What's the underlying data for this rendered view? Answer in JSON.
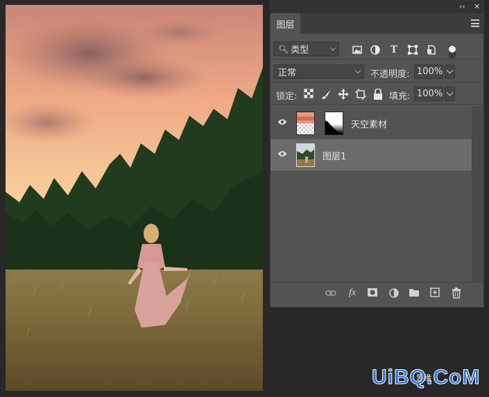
{
  "panel": {
    "window_controls": {
      "collapse": "‹‹",
      "close": "✕"
    },
    "tab_label": "图层",
    "filter": {
      "kind_label": "类型"
    },
    "blend": {
      "mode": "正常",
      "opacity_label": "不透明度:",
      "opacity_value": "100%"
    },
    "lock": {
      "label": "锁定:",
      "fill_label": "填充:",
      "fill_value": "100%"
    },
    "layers": [
      {
        "name": "天空素材",
        "visible": true,
        "selected": false
      },
      {
        "name": "图层1",
        "visible": true,
        "selected": true
      }
    ]
  },
  "watermark": {
    "text": "UiBQ.CoM",
    "badge": "思缘"
  },
  "colors": {
    "panel_bg": "#535353",
    "selected_row": "#6b6b6b",
    "watermark_blue": "#2f74c9"
  }
}
